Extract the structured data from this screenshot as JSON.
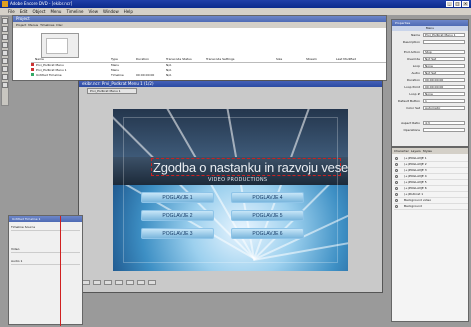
{
  "app": {
    "title": "Adobe Encore DVD - [ekibr.ncr]"
  },
  "menu": [
    "File",
    "Edit",
    "Object",
    "Menu",
    "Timeline",
    "View",
    "Window",
    "Help"
  ],
  "project_panel": {
    "title": "Project",
    "tabs": [
      "Project",
      "Menus",
      "Timelines",
      "Disc"
    ],
    "columns": [
      "Name",
      "Type",
      "Duration",
      "Transcode Status",
      "Transcode Settings",
      "Size",
      "Stream",
      "Last Modified"
    ],
    "rows": [
      {
        "name": "Prvi_Podkrat Menu",
        "type": "Menu",
        "duration": "",
        "status": "N/A",
        "settings": ""
      },
      {
        "name": "Prvi_Podkrat Menu 1",
        "type": "Menu",
        "duration": "",
        "status": "N/A",
        "settings": ""
      },
      {
        "name": "Untitled Timeline",
        "type": "Timeline",
        "duration": "00:00:00:00",
        "status": "N/A",
        "settings": ""
      }
    ]
  },
  "menu_editor": {
    "title": "ekibr.ncr: Prvi_Podkrat Menu 1 (1/2)",
    "tab": "Prvi_Podkrat Menu 1",
    "video_title": "Zgodba o nastanku in razvoju veselja",
    "video_subtitle": "VIDEO PRODUCTIONS",
    "chapters": [
      "POGLAVJE 1",
      "POGLAVJE 2",
      "POGLAVJE 3",
      "POGLAVJE 4",
      "POGLAVJE 5",
      "POGLAVJE 6"
    ]
  },
  "timeline_panel": {
    "title": "Untitled Timeline 1",
    "tabs": [
      "Timeline",
      "Source"
    ],
    "tracks": [
      "Video",
      "Audio 1"
    ]
  },
  "properties_panel": {
    "title": "Properties",
    "section": "Menu",
    "fields": [
      {
        "label": "Name",
        "value": "Prvi_Podkrat Menu 1"
      },
      {
        "label": "Description",
        "value": ""
      },
      {
        "label": "End Action",
        "value": "Stop"
      },
      {
        "label": "Override",
        "value": "Not Set"
      },
      {
        "label": "Loop",
        "value": "None"
      },
      {
        "label": "Audio",
        "value": "Not Set"
      },
      {
        "label": "Duration",
        "value": "00:00:00:00"
      },
      {
        "label": "Loop Point",
        "value": "00:00:00:00"
      },
      {
        "label": "Loop #",
        "value": "None"
      },
      {
        "label": "Default Button",
        "value": "1"
      },
      {
        "label": "Color Set",
        "value": "Automatic"
      },
      {
        "label": "Aspect Ratio",
        "value": "4:3"
      },
      {
        "label": "Operations",
        "value": ""
      }
    ]
  },
  "layers_panel": {
    "tabs": [
      "Character",
      "Layers",
      "Styles"
    ],
    "layers": [
      "(+)POGLAVJE 1",
      "(+)POGLAVJE 2",
      "(+)POGLAVJE 3",
      "(+)POGLAVJE 4",
      "(+)POGLAVJE 5",
      "(+)POGLAVJE 6",
      "(+)Podkrat 1",
      "Background video",
      "Background"
    ]
  }
}
